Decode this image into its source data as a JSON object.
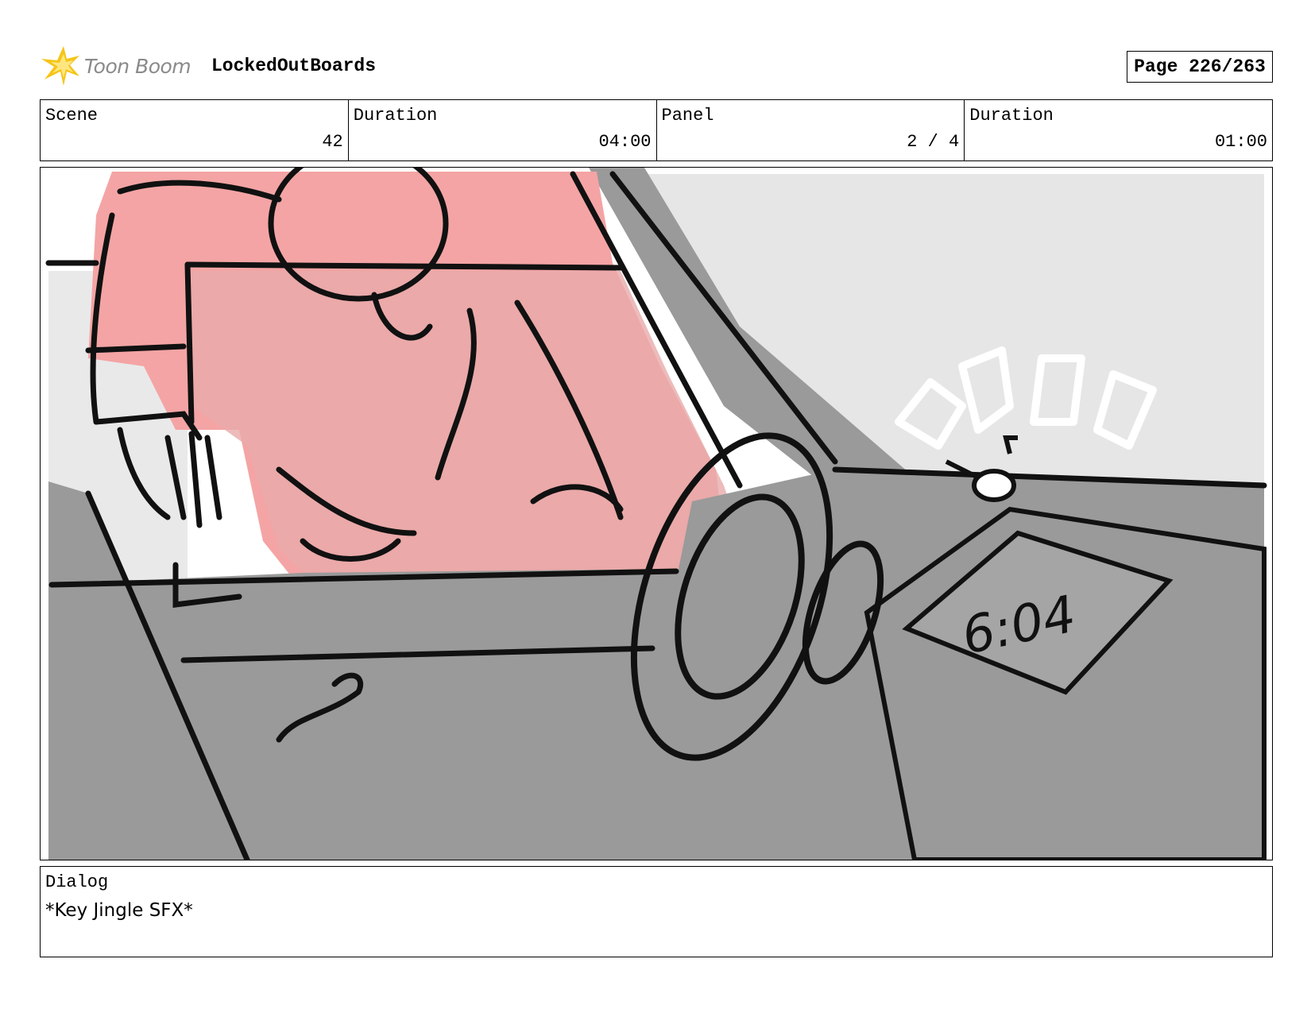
{
  "header": {
    "brand_name": "Toon Boom",
    "project_title": "LockedOutBoards",
    "page_label": "Page 226/263"
  },
  "info": {
    "scene_label": "Scene",
    "scene_value": "42",
    "scene_duration_label": "Duration",
    "scene_duration_value": "04:00",
    "panel_label": "Panel",
    "panel_value": "2 / 4",
    "panel_duration_label": "Duration",
    "panel_duration_value": "01:00"
  },
  "panel": {
    "clock_text": "6:04",
    "colors": {
      "character_pink": "#f4a4a4",
      "interior_gray": "#9a9a9a",
      "sky_gray": "#e6e6e6",
      "line": "#111111"
    }
  },
  "dialog": {
    "label": "Dialog",
    "text": "*Key Jingle SFX*"
  }
}
